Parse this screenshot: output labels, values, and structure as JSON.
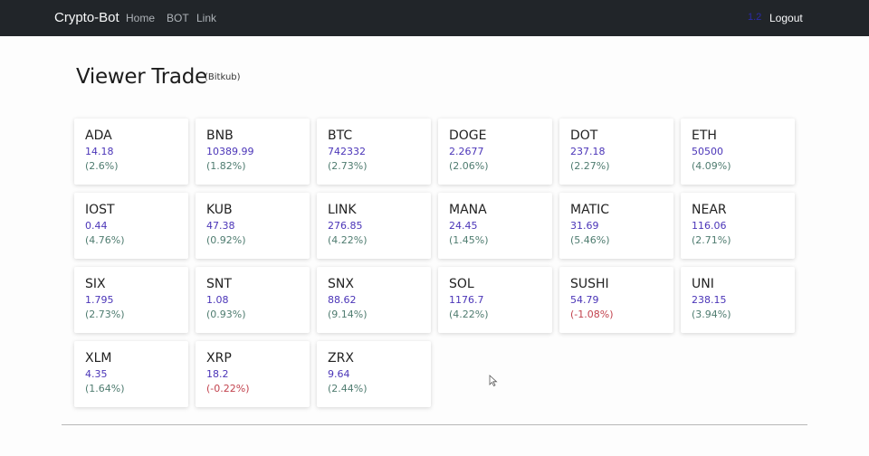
{
  "nav": {
    "brand": "Crypto-Bot",
    "links": [
      "Home",
      "BOT",
      "Link"
    ],
    "user_badge": "1.2",
    "logout": "Logout"
  },
  "page": {
    "title": "Viewer Trade",
    "subtitle": "(Bitkub)"
  },
  "coins": [
    {
      "symbol": "ADA",
      "price": "14.18",
      "change": "(2.6%)"
    },
    {
      "symbol": "BNB",
      "price": "10389.99",
      "change": "(1.82%)"
    },
    {
      "symbol": "BTC",
      "price": "742332",
      "change": "(2.73%)"
    },
    {
      "symbol": "DOGE",
      "price": "2.2677",
      "change": "(2.06%)"
    },
    {
      "symbol": "DOT",
      "price": "237.18",
      "change": "(2.27%)"
    },
    {
      "symbol": "ETH",
      "price": "50500",
      "change": "(4.09%)"
    },
    {
      "symbol": "IOST",
      "price": "0.44",
      "change": "(4.76%)"
    },
    {
      "symbol": "KUB",
      "price": "47.38",
      "change": "(0.92%)"
    },
    {
      "symbol": "LINK",
      "price": "276.85",
      "change": "(4.22%)"
    },
    {
      "symbol": "MANA",
      "price": "24.45",
      "change": "(1.45%)"
    },
    {
      "symbol": "MATIC",
      "price": "31.69",
      "change": "(5.46%)"
    },
    {
      "symbol": "NEAR",
      "price": "116.06",
      "change": "(2.71%)"
    },
    {
      "symbol": "SIX",
      "price": "1.795",
      "change": "(2.73%)"
    },
    {
      "symbol": "SNT",
      "price": "1.08",
      "change": "(0.93%)"
    },
    {
      "symbol": "SNX",
      "price": "88.62",
      "change": "(9.14%)"
    },
    {
      "symbol": "SOL",
      "price": "1176.7",
      "change": "(4.22%)"
    },
    {
      "symbol": "SUSHI",
      "price": "54.79",
      "change": "(-1.08%)"
    },
    {
      "symbol": "UNI",
      "price": "238.15",
      "change": "(3.94%)"
    },
    {
      "symbol": "XLM",
      "price": "4.35",
      "change": "(1.64%)"
    },
    {
      "symbol": "XRP",
      "price": "18.2",
      "change": "(-0.22%)"
    },
    {
      "symbol": "ZRX",
      "price": "9.64",
      "change": "(2.44%)"
    }
  ],
  "colors": {
    "navbar": "#212529",
    "price": "#4b35b8",
    "positive": "#4f7c70",
    "negative": "#c2434e"
  },
  "icons": {
    "cursor": "mouse-pointer-icon"
  }
}
